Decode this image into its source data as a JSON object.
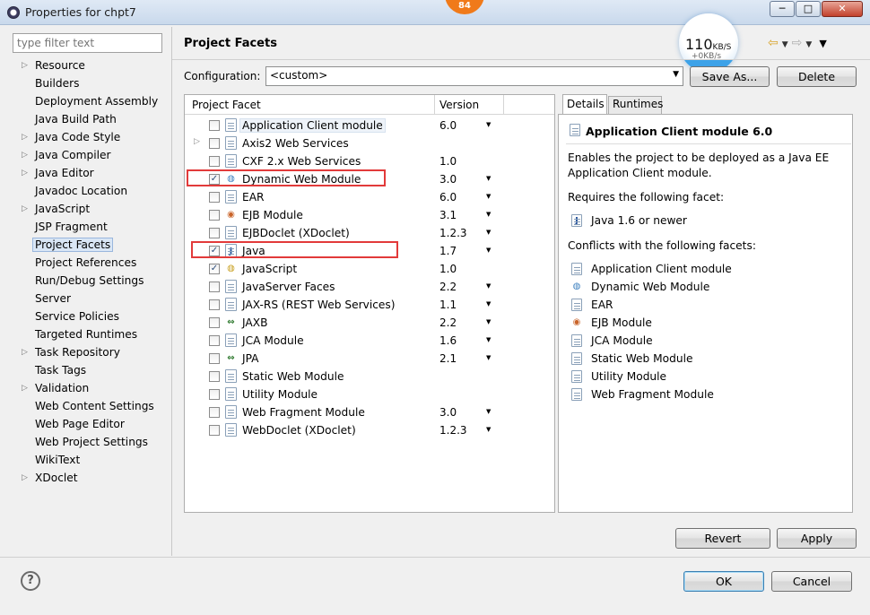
{
  "window": {
    "title": "Properties for chpt7",
    "notification_badge": "84",
    "controls": {
      "minimize": "─",
      "maximize": "□",
      "close": "✕"
    }
  },
  "filter": {
    "placeholder": "type filter text"
  },
  "nav": {
    "items": [
      {
        "label": "Resource",
        "expandable": true
      },
      {
        "label": "Builders",
        "expandable": false
      },
      {
        "label": "Deployment Assembly",
        "expandable": false
      },
      {
        "label": "Java Build Path",
        "expandable": false
      },
      {
        "label": "Java Code Style",
        "expandable": true
      },
      {
        "label": "Java Compiler",
        "expandable": true
      },
      {
        "label": "Java Editor",
        "expandable": true
      },
      {
        "label": "Javadoc Location",
        "expandable": false
      },
      {
        "label": "JavaScript",
        "expandable": true
      },
      {
        "label": "JSP Fragment",
        "expandable": false
      },
      {
        "label": "Project Facets",
        "expandable": false,
        "selected": true
      },
      {
        "label": "Project References",
        "expandable": false
      },
      {
        "label": "Run/Debug Settings",
        "expandable": false
      },
      {
        "label": "Server",
        "expandable": false
      },
      {
        "label": "Service Policies",
        "expandable": false
      },
      {
        "label": "Targeted Runtimes",
        "expandable": false
      },
      {
        "label": "Task Repository",
        "expandable": true
      },
      {
        "label": "Task Tags",
        "expandable": false
      },
      {
        "label": "Validation",
        "expandable": true
      },
      {
        "label": "Web Content Settings",
        "expandable": false
      },
      {
        "label": "Web Page Editor",
        "expandable": false
      },
      {
        "label": "Web Project Settings",
        "expandable": false
      },
      {
        "label": "WikiText",
        "expandable": false
      },
      {
        "label": "XDoclet",
        "expandable": true
      }
    ]
  },
  "header": {
    "title": "Project Facets",
    "back_icon": "back-arrow-icon",
    "forward_icon": "forward-arrow-icon"
  },
  "speed_widget": {
    "rate": "110",
    "rate_unit": "KB/S",
    "sub_rate": "+0KB/s"
  },
  "configuration": {
    "label": "Configuration:",
    "value": "<custom>",
    "save_as_label": "Save As...",
    "delete_label": "Delete"
  },
  "facets": {
    "column_facet": "Project Facet",
    "column_version": "Version",
    "rows": [
      {
        "name": "Application Client module",
        "version": "6.0",
        "checked": false,
        "icon": "doc",
        "has_dropdown": true,
        "selected": true
      },
      {
        "name": "Axis2 Web Services",
        "version": "",
        "checked": false,
        "icon": "doc",
        "has_dropdown": false,
        "expandable": true
      },
      {
        "name": "CXF 2.x Web Services",
        "version": "1.0",
        "checked": false,
        "icon": "doc",
        "has_dropdown": false
      },
      {
        "name": "Dynamic Web Module",
        "version": "3.0",
        "checked": true,
        "icon": "globe",
        "has_dropdown": true,
        "highlighted": true
      },
      {
        "name": "EAR",
        "version": "6.0",
        "checked": false,
        "icon": "doc",
        "has_dropdown": true
      },
      {
        "name": "EJB Module",
        "version": "3.1",
        "checked": false,
        "icon": "bean",
        "has_dropdown": true
      },
      {
        "name": "EJBDoclet (XDoclet)",
        "version": "1.2.3",
        "checked": false,
        "icon": "doc",
        "has_dropdown": true
      },
      {
        "name": "Java",
        "version": "1.7",
        "checked": true,
        "icon": "java",
        "has_dropdown": true,
        "highlighted": true
      },
      {
        "name": "JavaScript",
        "version": "1.0",
        "checked": true,
        "icon": "jsglobe",
        "has_dropdown": false
      },
      {
        "name": "JavaServer Faces",
        "version": "2.2",
        "checked": false,
        "icon": "doc",
        "has_dropdown": true
      },
      {
        "name": "JAX-RS (REST Web Services)",
        "version": "1.1",
        "checked": false,
        "icon": "doc",
        "has_dropdown": true
      },
      {
        "name": "JAXB",
        "version": "2.2",
        "checked": false,
        "icon": "arrows",
        "has_dropdown": true
      },
      {
        "name": "JCA Module",
        "version": "1.6",
        "checked": false,
        "icon": "doc",
        "has_dropdown": true
      },
      {
        "name": "JPA",
        "version": "2.1",
        "checked": false,
        "icon": "arrows",
        "has_dropdown": true
      },
      {
        "name": "Static Web Module",
        "version": "",
        "checked": false,
        "icon": "doc",
        "has_dropdown": false
      },
      {
        "name": "Utility Module",
        "version": "",
        "checked": false,
        "icon": "doc",
        "has_dropdown": false
      },
      {
        "name": "Web Fragment Module",
        "version": "3.0",
        "checked": false,
        "icon": "doc",
        "has_dropdown": true
      },
      {
        "name": "WebDoclet (XDoclet)",
        "version": "1.2.3",
        "checked": false,
        "icon": "doc",
        "has_dropdown": true
      }
    ]
  },
  "details": {
    "tab_details": "Details",
    "tab_runtimes": "Runtimes",
    "title": "Application Client module 6.0",
    "description": "Enables the project to be deployed as a Java EE Application Client module.",
    "requires_label": "Requires the following facet:",
    "requires": [
      {
        "name": "Java 1.6 or newer",
        "icon": "java"
      }
    ],
    "conflicts_label": "Conflicts with the following facets:",
    "conflicts": [
      {
        "name": "Application Client module",
        "icon": "doc"
      },
      {
        "name": "Dynamic Web Module",
        "icon": "globe"
      },
      {
        "name": "EAR",
        "icon": "doc"
      },
      {
        "name": "EJB Module",
        "icon": "bean"
      },
      {
        "name": "JCA Module",
        "icon": "doc"
      },
      {
        "name": "Static Web Module",
        "icon": "doc"
      },
      {
        "name": "Utility Module",
        "icon": "doc"
      },
      {
        "name": "Web Fragment Module",
        "icon": "doc"
      }
    ]
  },
  "buttons": {
    "revert": "Revert",
    "apply": "Apply",
    "ok": "OK",
    "cancel": "Cancel",
    "help_icon": "help-icon"
  },
  "colors": {
    "highlight_box": "#e23a3a",
    "selection": "#d9e6f5"
  }
}
